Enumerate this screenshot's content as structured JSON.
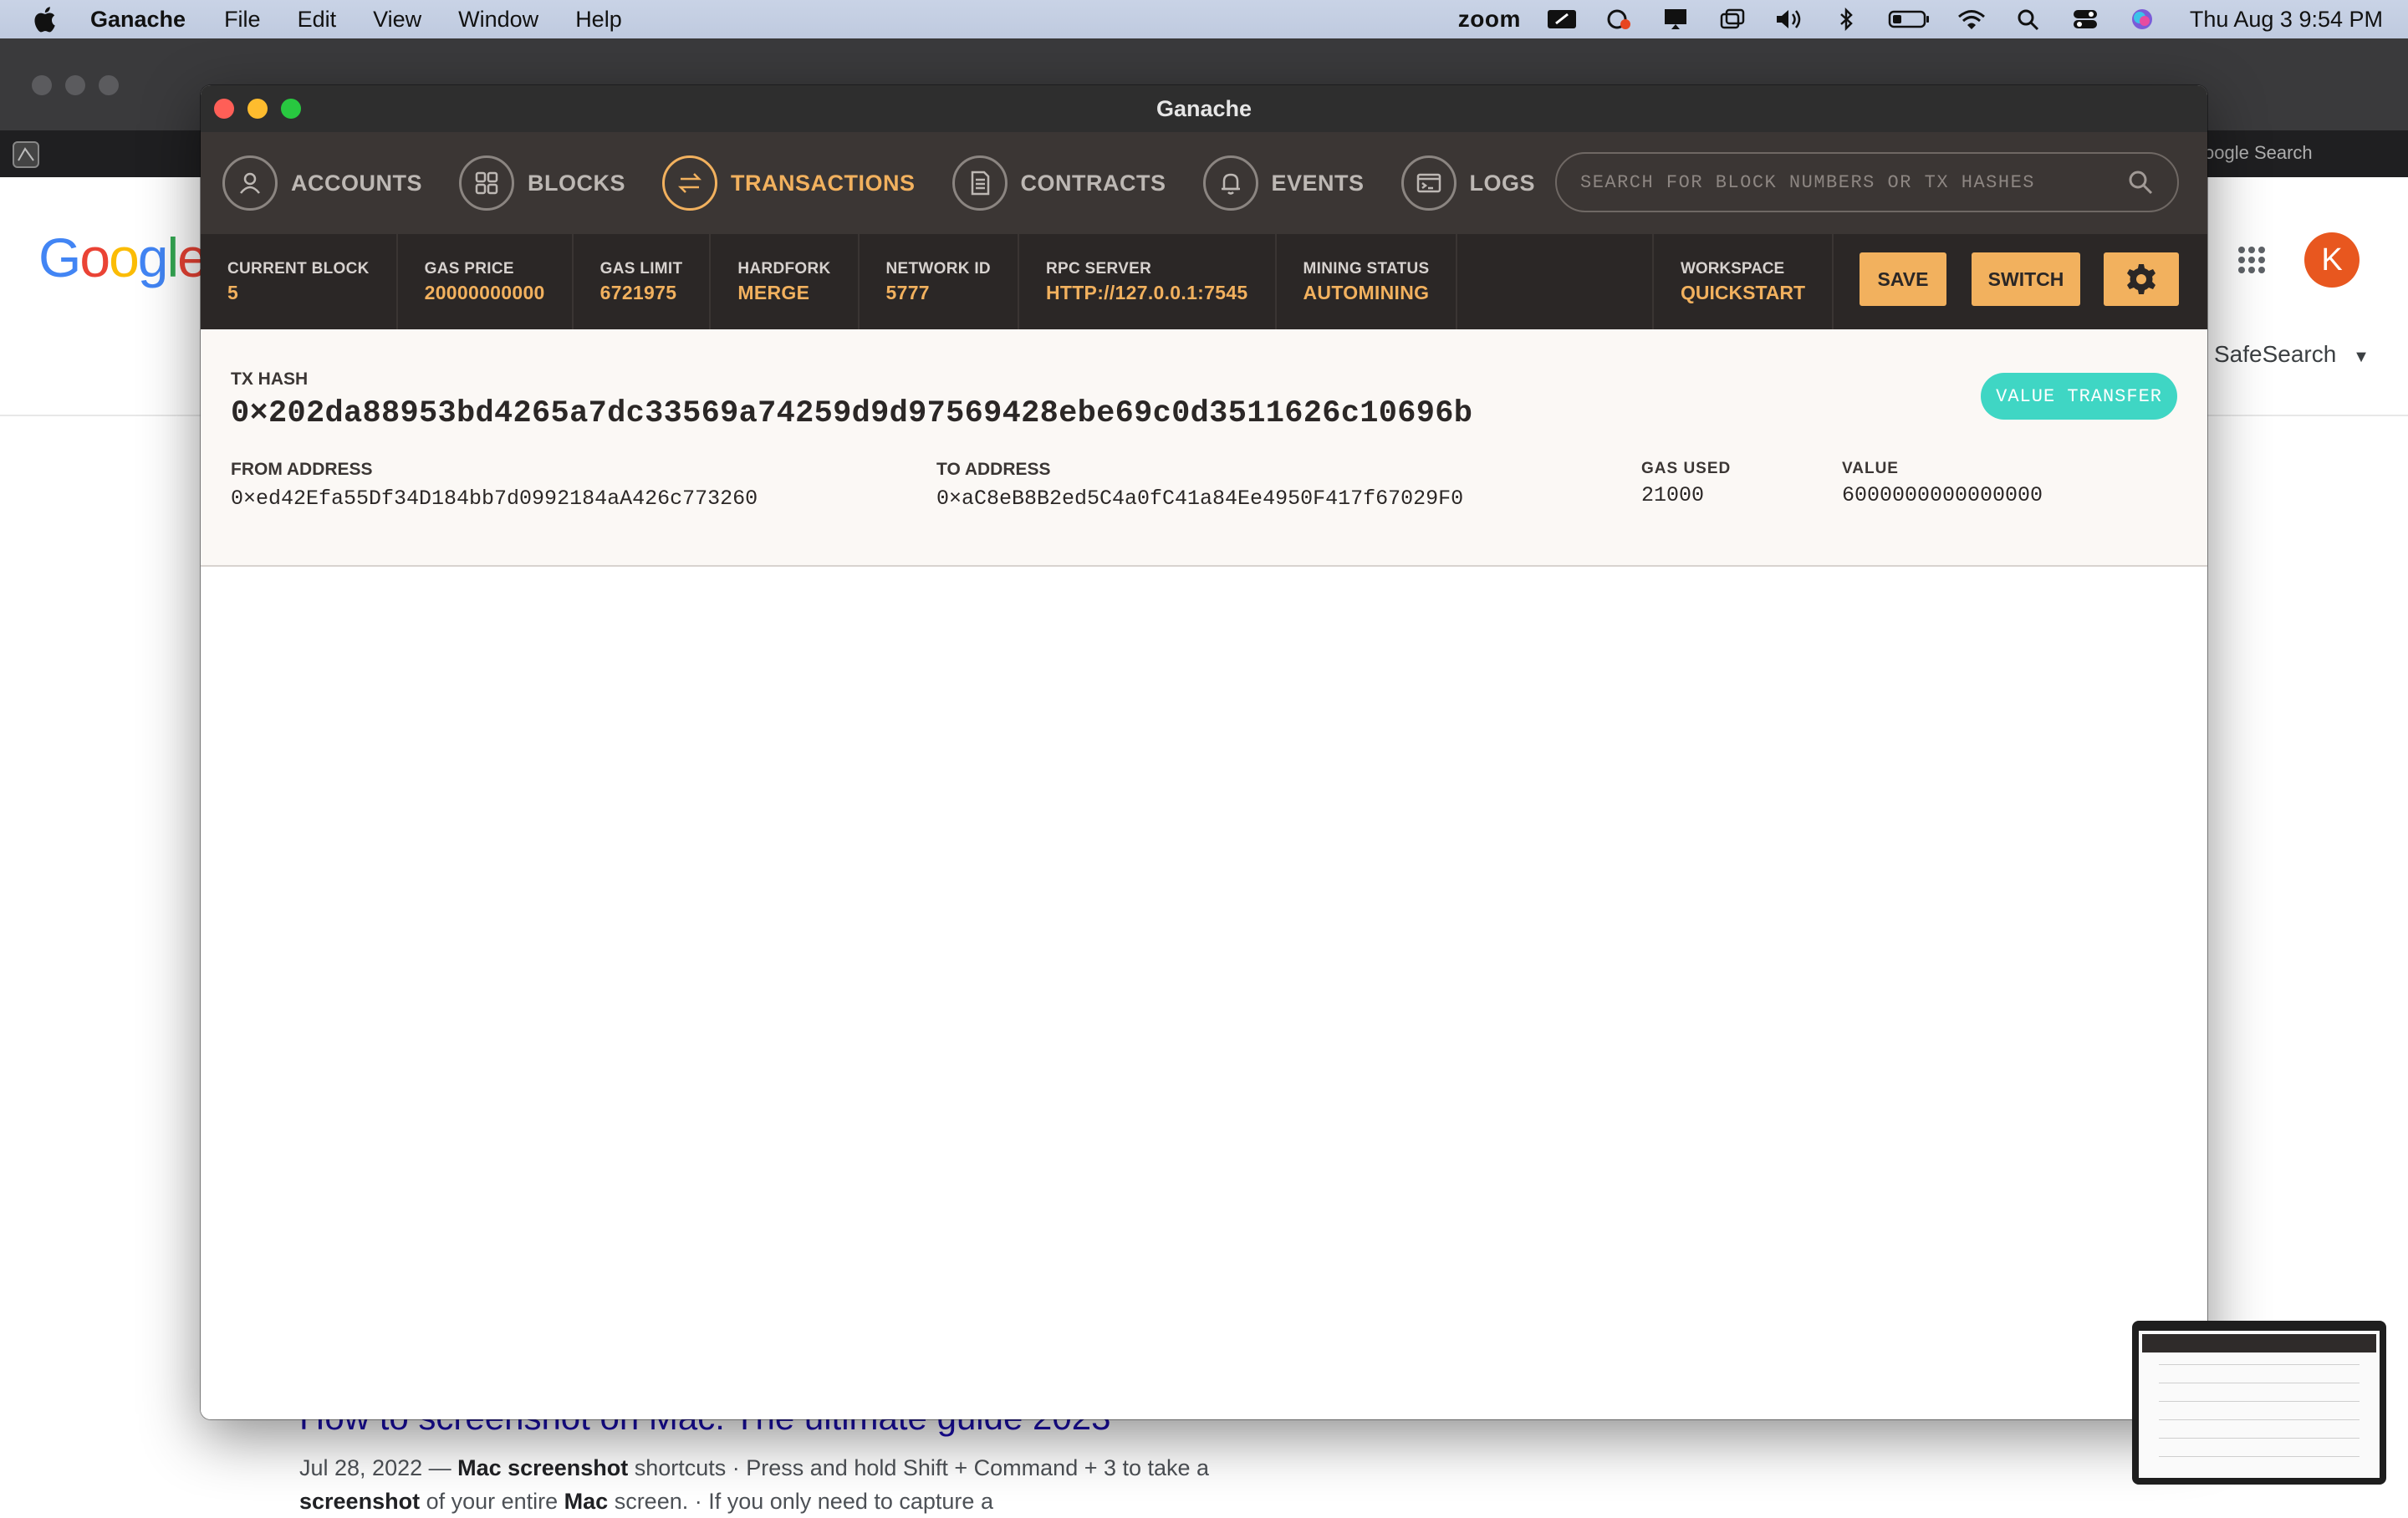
{
  "menubar": {
    "app": "Ganache",
    "items": [
      "File",
      "Edit",
      "View",
      "Window",
      "Help"
    ],
    "zoom_label": "zoom",
    "clock": "Thu Aug 3  9:54 PM"
  },
  "browser": {
    "google_logo": "Google",
    "avatar_initial": "K",
    "safesearch": "SafeSearch",
    "google_search_hint": "oogle Search",
    "result_title": "How to screenshot on Mac: The ultimate guide 2023",
    "result_date": "Jul 28, 2022 — ",
    "result_snippet_b1": "Mac screenshot",
    "result_snippet_1": " shortcuts · Press and hold Shift + Command + 3 to take a ",
    "result_snippet_b2": "screenshot",
    "result_snippet_2": " of your entire ",
    "result_snippet_b3": "Mac",
    "result_snippet_3": " screen. · If you only need to capture a"
  },
  "window": {
    "title": "Ganache"
  },
  "nav": {
    "items": [
      {
        "label": "ACCOUNTS",
        "icon": "person-icon"
      },
      {
        "label": "BLOCKS",
        "icon": "grid-icon"
      },
      {
        "label": "TRANSACTIONS",
        "icon": "arrows-swap-icon"
      },
      {
        "label": "CONTRACTS",
        "icon": "document-icon"
      },
      {
        "label": "EVENTS",
        "icon": "bell-icon"
      },
      {
        "label": "LOGS",
        "icon": "terminal-icon"
      }
    ],
    "active": "TRANSACTIONS",
    "search_placeholder": "SEARCH FOR BLOCK NUMBERS OR TX HASHES"
  },
  "status": {
    "current_block": {
      "label": "CURRENT BLOCK",
      "value": "5"
    },
    "gas_price": {
      "label": "GAS PRICE",
      "value": "20000000000"
    },
    "gas_limit": {
      "label": "GAS LIMIT",
      "value": "6721975"
    },
    "hardfork": {
      "label": "HARDFORK",
      "value": "MERGE"
    },
    "network_id": {
      "label": "NETWORK ID",
      "value": "5777"
    },
    "rpc_server": {
      "label": "RPC SERVER",
      "value": "HTTP://127.0.0.1:7545"
    },
    "mining_status": {
      "label": "MINING STATUS",
      "value": "AUTOMINING"
    },
    "workspace": {
      "label": "WORKSPACE",
      "value": "QUICKSTART"
    },
    "save_label": "SAVE",
    "switch_label": "SWITCH"
  },
  "transaction": {
    "hash_label": "TX HASH",
    "hash": "0×202da88953bd4265a7dc33569a74259d9d97569428ebe69c0d3511626c10696b",
    "badge": "VALUE TRANSFER",
    "from_label": "FROM ADDRESS",
    "from": "0×ed42Efa55Df34D184bb7d0992184aA426c773260",
    "to_label": "TO ADDRESS",
    "to": "0×aC8eB8B2ed5C4a0fC41a84Ee4950F417f67029F0",
    "gas_used_label": "GAS USED",
    "gas_used": "21000",
    "value_label": "VALUE",
    "value": "6000000000000000"
  },
  "colors": {
    "accent": "#f2b15e",
    "nav_bg": "#3b3634",
    "status_bg": "#2b2726",
    "badge": "#3fd6c4"
  }
}
